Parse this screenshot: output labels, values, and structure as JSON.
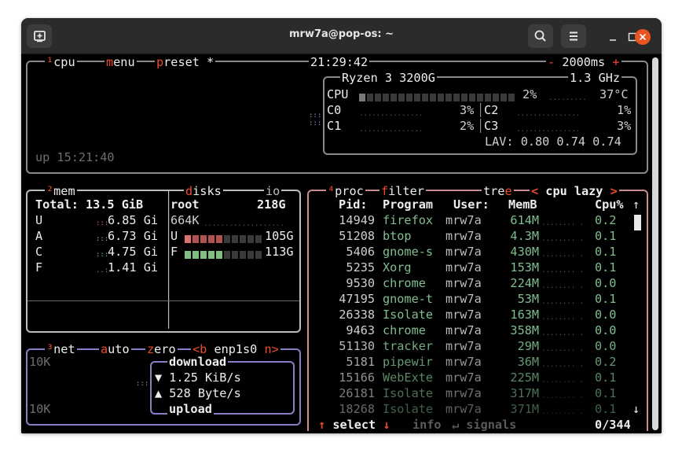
{
  "window": {
    "title": "mrw7a@pop-os: ~"
  },
  "cpu_box": {
    "label_num": "¹",
    "label": "cpu",
    "menu": "menu",
    "preset": "preset *",
    "clock": "21:29:42",
    "interval": "2000ms",
    "minus": "-",
    "plus": "+",
    "uptime": "up 15:21:40",
    "model": "Ryzen 3 3200G",
    "freq": "1.3 GHz",
    "total": {
      "name": "CPU",
      "pct": "2%",
      "temp": "37°C"
    },
    "cores": [
      {
        "name": "C0",
        "pct": "3%"
      },
      {
        "name": "C1",
        "pct": "2%"
      },
      {
        "name": "C2",
        "pct": "1%"
      },
      {
        "name": "C3",
        "pct": "3%"
      }
    ],
    "lav": "LAV: 0.80 0.74 0.74"
  },
  "mem_box": {
    "label_num": "²",
    "label": "mem",
    "total": "Total: 13.5 GiB",
    "rows": [
      {
        "k": "U",
        "v": "6.85 Gi"
      },
      {
        "k": "A",
        "v": "6.73 Gi"
      },
      {
        "k": "C",
        "v": "4.75 Gi"
      },
      {
        "k": "F",
        "v": "1.41 Gi"
      }
    ]
  },
  "disks_box": {
    "label": "disks",
    "io": "io",
    "name": "root",
    "size": "218G",
    "io_val": "664K",
    "used_label": "U",
    "used": "105G",
    "free_label": "F",
    "free": "113G",
    "used_fraction": 0.48,
    "free_fraction": 0.52
  },
  "net_box": {
    "label_num": "³",
    "label": "net",
    "auto": "auto",
    "zero": "zero",
    "b": "<b",
    "iface": "enp1s0",
    "n": "n>",
    "scale_top": "10K",
    "scale_bot": "10K",
    "download": "download",
    "download_rate": "▼ 1.25 KiB/s",
    "upload_rate": "▲ 528 Byte/s",
    "upload": "upload"
  },
  "proc_box": {
    "label_num": "⁴",
    "label": "proc",
    "filter": "filter",
    "tree": "tree",
    "sort": "< cpu lazy >",
    "headers": {
      "pid": "Pid:",
      "program": "Program",
      "user": "User:",
      "mem": "MemB",
      "cpu": "Cpu%"
    },
    "rows": [
      {
        "pid": "14949",
        "program": "firefox",
        "user": "mrw7a",
        "mem": "614M",
        "cpu": "0.2"
      },
      {
        "pid": "51208",
        "program": "btop",
        "user": "mrw7a",
        "mem": "4.3M",
        "cpu": "0.1"
      },
      {
        "pid": "5406",
        "program": "gnome-s",
        "user": "mrw7a",
        "mem": "430M",
        "cpu": "0.1"
      },
      {
        "pid": "5235",
        "program": "Xorg",
        "user": "mrw7a",
        "mem": "153M",
        "cpu": "0.1"
      },
      {
        "pid": "9530",
        "program": "chrome",
        "user": "mrw7a",
        "mem": "224M",
        "cpu": "0.0"
      },
      {
        "pid": "47195",
        "program": "gnome-t",
        "user": "mrw7a",
        "mem": "53M",
        "cpu": "0.1"
      },
      {
        "pid": "26338",
        "program": "Isolate",
        "user": "mrw7a",
        "mem": "163M",
        "cpu": "0.0"
      },
      {
        "pid": "9463",
        "program": "chrome",
        "user": "mrw7a",
        "mem": "358M",
        "cpu": "0.0"
      },
      {
        "pid": "51130",
        "program": "tracker",
        "user": "mrw7a",
        "mem": "29M",
        "cpu": "0.0"
      },
      {
        "pid": "5181",
        "program": "pipewir",
        "user": "mrw7a",
        "mem": "36M",
        "cpu": "0.2"
      },
      {
        "pid": "15166",
        "program": "WebExte",
        "user": "mrw7a",
        "mem": "225M",
        "cpu": "0.1"
      },
      {
        "pid": "26181",
        "program": "Isolate",
        "user": "mrw7a",
        "mem": "317M",
        "cpu": "0.1"
      },
      {
        "pid": "18268",
        "program": "Isolate",
        "user": "mrw7a",
        "mem": "371M",
        "cpu": "0.1"
      }
    ],
    "footer": {
      "select": "select",
      "info": "info",
      "signals": "signals",
      "count": "0/344"
    }
  },
  "colors": {
    "cpu_border": "#8a8a8a",
    "mem_border": "#bdbdbd",
    "net_border": "#8a7fc7",
    "proc_border": "#c98c8c",
    "accent": "#ee4b2b",
    "title_bar": "#2b2b2b",
    "close": "#e95420"
  }
}
